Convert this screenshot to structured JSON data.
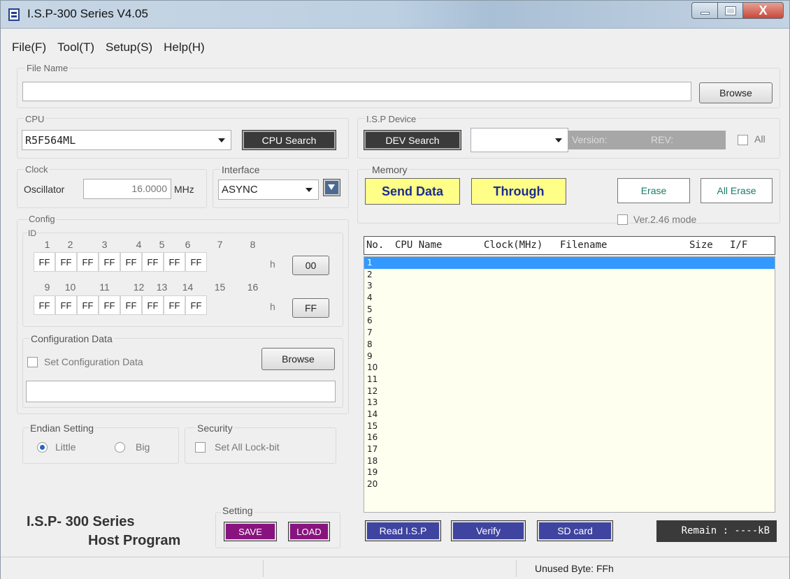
{
  "window": {
    "title": "I.S.P-300 Series V4.05",
    "close_glyph": "X"
  },
  "menu": [
    "File(F)",
    "Tool(T)",
    "Setup(S)",
    "Help(H)"
  ],
  "file_name": {
    "legend": "File Name",
    "value": "",
    "browse": "Browse"
  },
  "cpu": {
    "legend": "CPU",
    "selected": "R5F564ML",
    "search": "CPU Search"
  },
  "isp_device": {
    "legend": "I.S.P Device",
    "dev_search": "DEV Search",
    "selected": "",
    "version_label": "Version:",
    "rev_label": "REV:",
    "all_label": "All"
  },
  "clock": {
    "legend": "Clock",
    "oscillator_label": "Oscillator",
    "value": "16.0000",
    "unit": "MHz"
  },
  "interface": {
    "legend": "Interface",
    "selected": "ASYNC"
  },
  "config": {
    "legend": "Config",
    "id_label": "ID",
    "row1_nums": [
      "1",
      "2",
      "3",
      "4",
      "5",
      "6",
      "7",
      "8"
    ],
    "row1_vals": [
      "FF",
      "FF",
      "FF",
      "FF",
      "FF",
      "FF",
      "FF",
      "FF"
    ],
    "row2_nums": [
      "9",
      "10",
      "11",
      "12",
      "13",
      "14",
      "15",
      "16"
    ],
    "row2_vals": [
      "FF",
      "FF",
      "FF",
      "FF",
      "FF",
      "FF",
      "FF",
      "FF"
    ],
    "h": "h",
    "btn1": "00",
    "btn2": "FF"
  },
  "config_data": {
    "legend": "Configuration Data",
    "checkbox_label": "Set Configuration Data",
    "browse": "Browse",
    "path": ""
  },
  "endian": {
    "legend": "Endian Setting",
    "little": "Little",
    "big": "Big",
    "selected": "Little"
  },
  "security": {
    "legend": "Security",
    "checkbox_label": "Set All Lock-bit"
  },
  "memory": {
    "legend": "Memory",
    "send_data": "Send Data",
    "through": "Through",
    "erase": "Erase",
    "all_erase": "All Erase",
    "ver_mode": "Ver.2.46 mode"
  },
  "list": {
    "headers": [
      "No.",
      "CPU Name",
      "Clock(MHz)",
      "Filename",
      "Size",
      "I/F"
    ],
    "rows": [
      "1",
      "2",
      "3",
      "4",
      "5",
      "6",
      "7",
      "8",
      "9",
      "10",
      "11",
      "12",
      "13",
      "14",
      "15",
      "16",
      "17",
      "18",
      "19",
      "20"
    ],
    "selected_row": "1"
  },
  "bottom": {
    "read": "Read I.S.P",
    "verify": "Verify",
    "sd_card": "SD card",
    "remain": "Remain : ----kB",
    "setting_legend": "Setting",
    "save": "SAVE",
    "load": "LOAD",
    "brand_line1": "I.S.P- 300  Series",
    "brand_line2": "Host Program"
  },
  "status": {
    "unused_byte": "Unused Byte: FFh"
  },
  "colors": {
    "send_bg": "#ffff88",
    "btn_blue": "#3f44a0",
    "btn_purple": "#88137f",
    "list_bg": "#fffff0",
    "selection": "#3399ff"
  }
}
